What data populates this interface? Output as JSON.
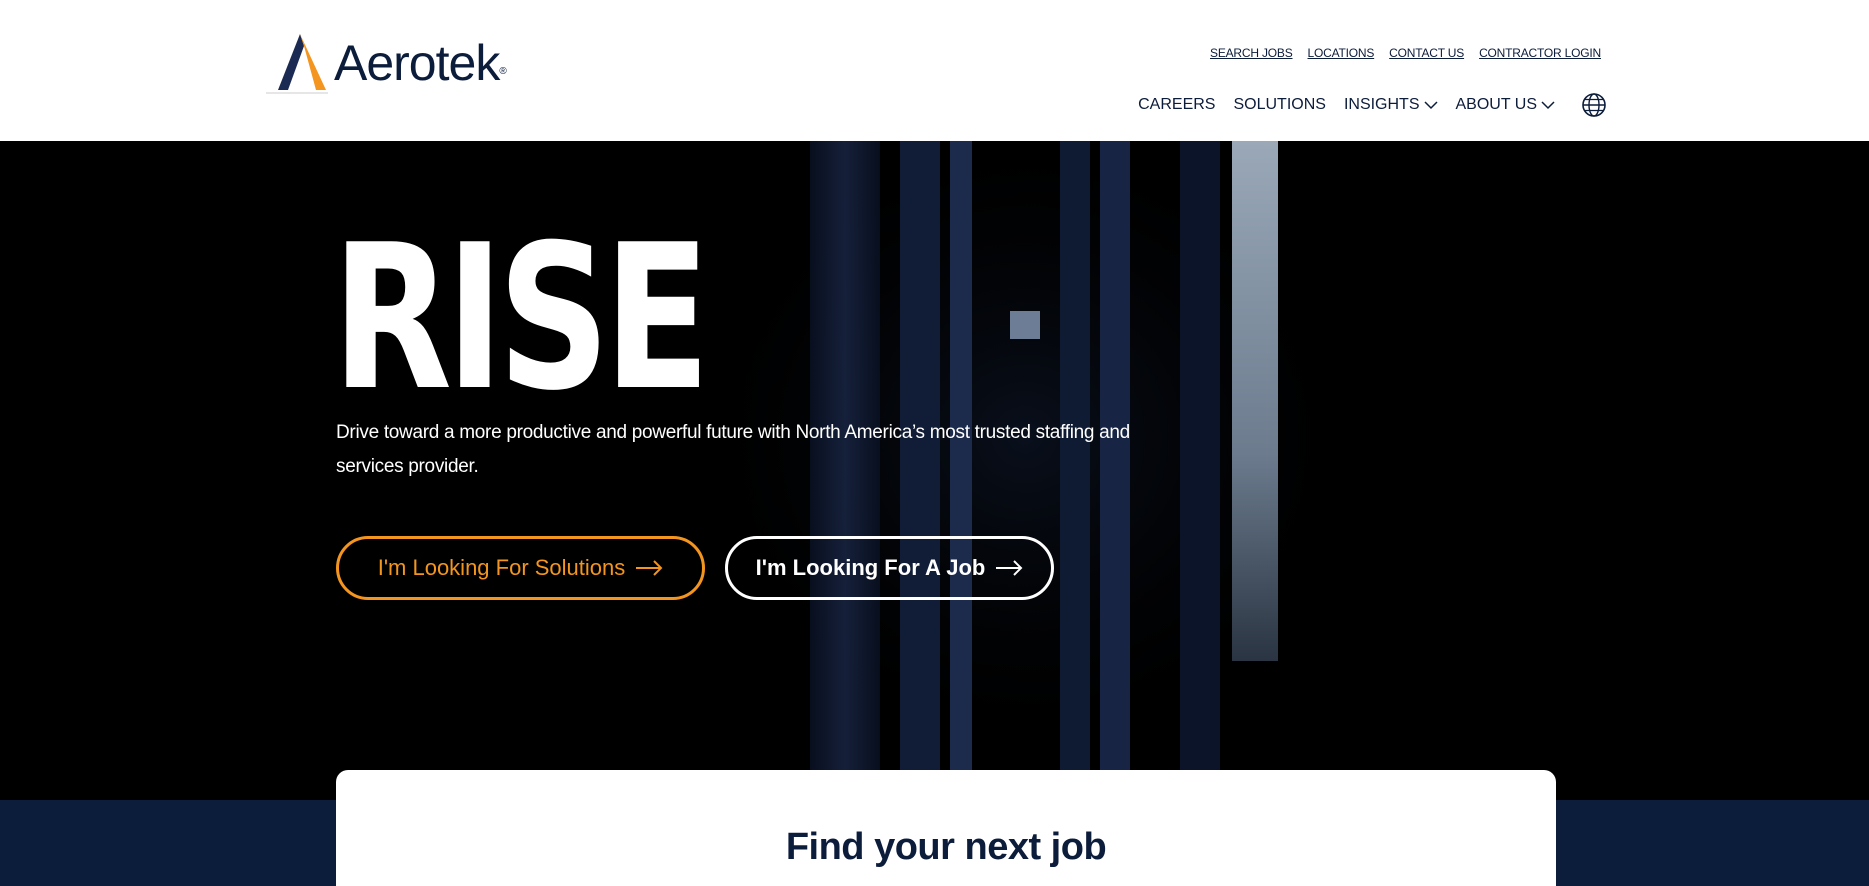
{
  "header": {
    "logo_text": "Aerotek",
    "utility_links": [
      "SEARCH JOBS",
      "LOCATIONS",
      "CONTACT US",
      "CONTRACTOR LOGIN"
    ],
    "nav": {
      "careers": "CAREERS",
      "solutions": "SOLUTIONS",
      "insights": "INSIGHTS",
      "about": "ABOUT US"
    }
  },
  "hero": {
    "title": "RISE",
    "subtitle": "Drive toward a more productive and powerful future with North America’s most trusted staffing and services provider.",
    "btn_solutions": "I'm Looking For Solutions",
    "btn_job": "I'm Looking For A Job"
  },
  "search_card": {
    "title": "Find your next job"
  },
  "colors": {
    "navy": "#0c1c3b",
    "orange": "#f3951f",
    "white": "#ffffff",
    "black": "#000000"
  },
  "icons": [
    "aerotek-logo-icon",
    "chevron-down-icon",
    "globe-icon",
    "arrow-right-icon"
  ]
}
